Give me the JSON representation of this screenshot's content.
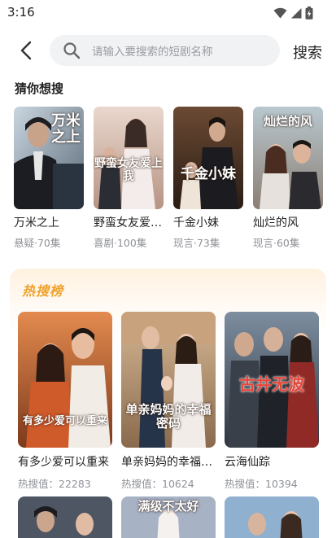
{
  "status_bar": {
    "time": "3:16"
  },
  "search": {
    "placeholder": "请输入要搜索的短剧名称",
    "submit_label": "搜索"
  },
  "guess": {
    "title": "猜你想搜",
    "items": [
      {
        "name": "万米之上",
        "meta": "悬疑·70集",
        "poster_text": "万米之上"
      },
      {
        "name": "野蛮女友爱上我",
        "meta": "喜剧·100集",
        "poster_text": "野蛮女友爱上我"
      },
      {
        "name": "千金小妹",
        "meta": "现言·73集",
        "poster_text": "千金小妹"
      },
      {
        "name": "灿烂的风",
        "meta": "现言·60集",
        "poster_text": "灿烂的风"
      }
    ]
  },
  "hot": {
    "title": "热搜榜",
    "items": [
      {
        "name": "有多少爱可以重来",
        "heat": "热搜值：22283",
        "poster_text": "有多少爱可以重来"
      },
      {
        "name": "单亲妈妈的幸福密码",
        "heat": "热搜值：10624",
        "poster_text": "单亲妈妈的幸福密码"
      },
      {
        "name": "云海仙踪",
        "heat": "热搜值：10394",
        "poster_text": "古井无波"
      }
    ],
    "row2_poster_texts": [
      "",
      "",
      "满级不太好"
    ]
  },
  "icons": {
    "back": "chevron-left-icon",
    "search": "search-icon",
    "wifi": "wifi-icon",
    "signal": "cell-signal-icon",
    "battery": "battery-icon"
  },
  "colors": {
    "accent": "#f0a12c",
    "muted_text": "#8f9197",
    "search_bg": "#f1f2f4"
  }
}
